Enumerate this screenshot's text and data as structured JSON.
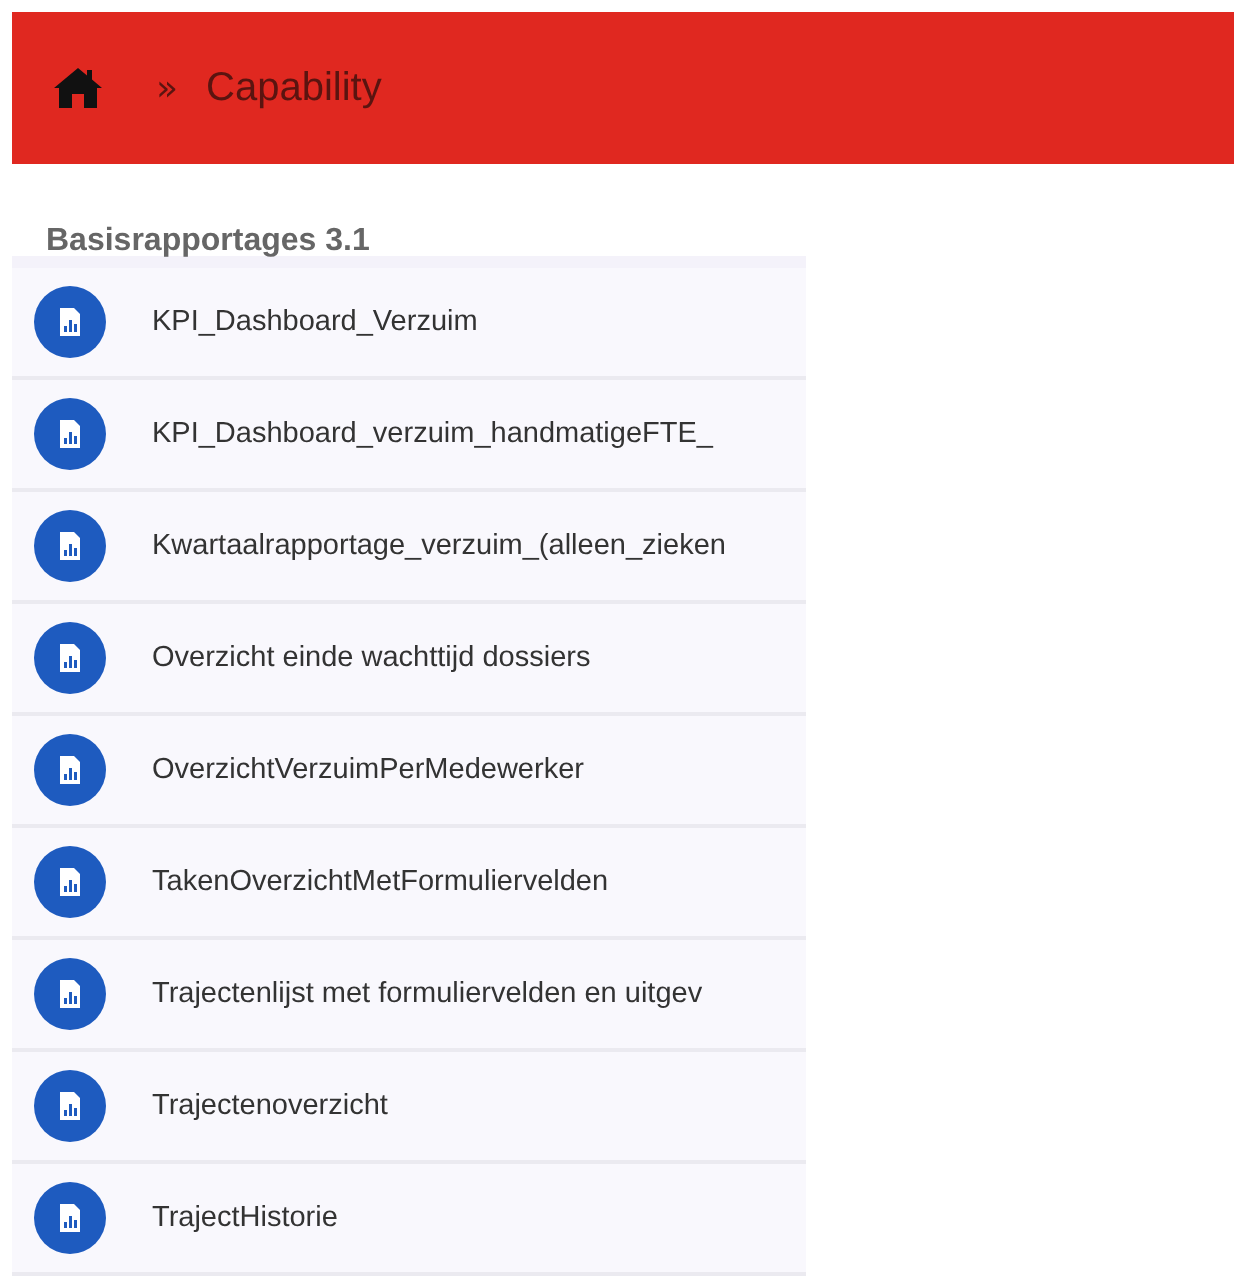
{
  "header": {
    "separator": "»",
    "breadcrumb": "Capability"
  },
  "section": {
    "title": "Basisrapportages 3.1"
  },
  "reports": [
    {
      "name": "KPI_Dashboard_Verzuim"
    },
    {
      "name": "KPI_Dashboard_verzuim_handmatigeFTE_"
    },
    {
      "name": "Kwartaalrapportage_verzuim_(alleen_zieken"
    },
    {
      "name": "Overzicht einde wachttijd dossiers"
    },
    {
      "name": "OverzichtVerzuimPerMedewerker"
    },
    {
      "name": "TakenOverzichtMetFormuliervelden"
    },
    {
      "name": "Trajectenlijst met formuliervelden en uitgev"
    },
    {
      "name": "Trajectenoverzicht"
    },
    {
      "name": "TrajectHistorie"
    }
  ]
}
